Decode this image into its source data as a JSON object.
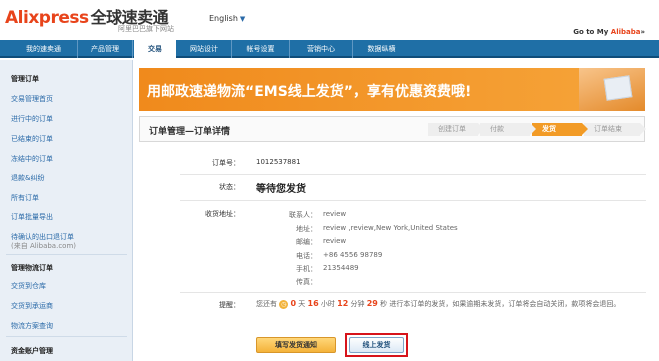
{
  "header": {
    "logo_ali": "Ali",
    "logo_xpress": "xpress",
    "logo_cn": "全球速卖通",
    "logo_sub": "阿里巴巴旗下网站",
    "language": "English",
    "goto_prefix": "Go to My ",
    "goto_brand": "Alibaba",
    "goto_suffix": "»"
  },
  "nav": [
    {
      "label": "我的速卖通"
    },
    {
      "label": "产品管理"
    },
    {
      "label": "交易"
    },
    {
      "label": "网站设计"
    },
    {
      "label": "帐号设置"
    },
    {
      "label": "营销中心"
    },
    {
      "label": "数据纵横"
    }
  ],
  "sidebar": {
    "section1_title": "管理订单",
    "items1": [
      "交易管理首页",
      "进行中的订单",
      "已结束的订单",
      "冻结中的订单",
      "退款&纠纷",
      "所有订单",
      "订单批量导出",
      "待确认的出口退订单"
    ],
    "items1_note": "(来自 Alibaba.com)",
    "section2_title": "管理物流订单",
    "items2": [
      "交货到仓库",
      "交货到承运商",
      "物流方案查询"
    ],
    "section3_title": "资金账户管理"
  },
  "banner": {
    "text": "用邮政速递物流“EMS线上发货”，享有优惠资费哦!"
  },
  "order": {
    "title": "订单管理—订单详情",
    "steps": [
      "创建订单",
      "付款",
      "发货",
      "订单结束"
    ],
    "active_step": 2,
    "order_no_label": "订单号：",
    "order_no": "1012537881",
    "status_label": "状态：",
    "status": "等待您发货",
    "address_label": "收货地址：",
    "address": [
      {
        "k": "联系人：",
        "v": "review"
      },
      {
        "k": "地址：",
        "v": "review ,review,New York,United States"
      },
      {
        "k": "邮编：",
        "v": "review"
      },
      {
        "k": "电话：",
        "v": "+86 4556 98789"
      },
      {
        "k": "手机：",
        "v": "21354489"
      },
      {
        "k": "传真：",
        "v": ""
      }
    ],
    "reminder_label": "提醒：",
    "reminder_pre": "您还有",
    "days": "0",
    "days_unit": "天",
    "hours": "16",
    "hours_unit": "小时",
    "minutes": "12",
    "minutes_unit": "分钟",
    "seconds": "29",
    "seconds_unit": "秒",
    "reminder_post": "进行本订单的发货，如果逾期未发货，订单将会自动关闭，款项将会退回。"
  },
  "buttons": {
    "fill_notice": "填写发货通知",
    "online_ship": "线上发货"
  },
  "colors": {
    "brand_orange": "#e8441b",
    "nav_blue": "#1f6fa6",
    "highlight_red": "#d7141b"
  }
}
